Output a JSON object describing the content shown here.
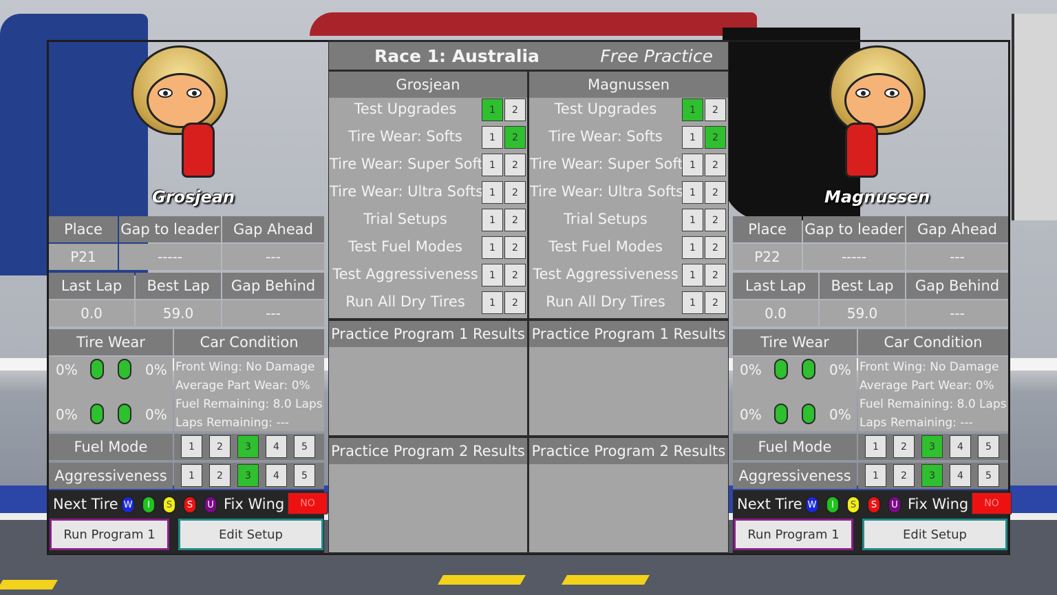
{
  "race": {
    "title": "Race 1: Australia",
    "session": "Free Practice"
  },
  "programs": {
    "items": [
      "Test Upgrades",
      "Tire Wear: Softs",
      "Tire Wear: Super Softs",
      "Tire Wear: Ultra Softs",
      "Trial Setups",
      "Test Fuel Modes",
      "Test Aggressiveness",
      "Run All Dry Tires"
    ],
    "results1": "Practice Program 1 Results",
    "results2": "Practice Program 2 Results",
    "slot1": "1",
    "slot2": "2"
  },
  "headers": {
    "place": "Place",
    "gap_leader": "Gap to leader",
    "gap_ahead": "Gap Ahead",
    "last_lap": "Last Lap",
    "best_lap": "Best Lap",
    "gap_behind": "Gap Behind",
    "tire_wear": "Tire Wear",
    "car_condition": "Car Condition",
    "fuel_mode": "Fuel Mode",
    "aggressiveness": "Aggressiveness",
    "next_tire": "Next Tire",
    "fix_wing": "Fix Wing",
    "no": "NO",
    "run_program": "Run Program 1",
    "edit_setup": "Edit Setup"
  },
  "tires": [
    {
      "letter": "W",
      "color": "#1a28e0"
    },
    {
      "letter": "I",
      "color": "#1fc21f"
    },
    {
      "letter": "S",
      "color": "#f2ee16"
    },
    {
      "letter": "S",
      "color": "#ee1111"
    },
    {
      "letter": "U",
      "color": "#7a0a8a"
    }
  ],
  "mode_levels": [
    "1",
    "2",
    "3",
    "4",
    "5"
  ],
  "drivers": [
    {
      "name": "Grosjean",
      "place": "P21",
      "gap_leader": "-----",
      "gap_ahead": "---",
      "last_lap": "0.0",
      "best_lap": "59.0",
      "gap_behind": "---",
      "wear": {
        "fl": "0%",
        "fr": "0%",
        "rl": "0%",
        "rr": "0%"
      },
      "condition": [
        "Front Wing: No Damage",
        "Average Part Wear: 0%",
        "Fuel Remaining: 8.0 Laps",
        "Laps Remaining: ---"
      ],
      "fuel_mode": 3,
      "aggressiveness": 3,
      "program_selection": {
        "Test Upgrades": 1,
        "Tire Wear: Softs": 2
      }
    },
    {
      "name": "Magnussen",
      "place": "P22",
      "gap_leader": "-----",
      "gap_ahead": "---",
      "last_lap": "0.0",
      "best_lap": "59.0",
      "gap_behind": "---",
      "wear": {
        "fl": "0%",
        "fr": "0%",
        "rl": "0%",
        "rr": "0%"
      },
      "condition": [
        "Front Wing: No Damage",
        "Average Part Wear: 0%",
        "Fuel Remaining: 8.0 Laps",
        "Laps Remaining: ---"
      ],
      "fuel_mode": 3,
      "aggressiveness": 3,
      "program_selection": {
        "Test Upgrades": 1,
        "Tire Wear: Softs": 2
      }
    }
  ]
}
